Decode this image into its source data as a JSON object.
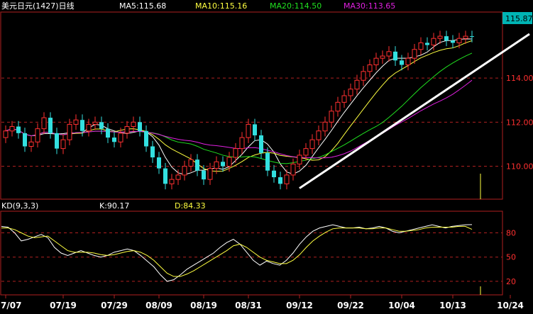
{
  "colors": {
    "background": "#000000",
    "frame": "#b02020",
    "grid": "#b02020",
    "up_candle": "#ff3030",
    "down_candle": "#33e0e0",
    "ma5": "#ffffff",
    "ma10": "#ffff40",
    "ma20": "#20e020",
    "ma30": "#e020e0",
    "k_line": "#ffffff",
    "d_line": "#ffff40",
    "trendline": "#ffffff",
    "axis_text": "#ff3030",
    "date_text": "#ffffff",
    "last_price_bg": "#00b4b4"
  },
  "price_header": {
    "title": "美元日元(1427)日线",
    "ma5": "MA5:115.68",
    "ma10": "MA10:115.16",
    "ma20": "MA20:114.50",
    "ma30": "MA30:113.65"
  },
  "last_price_tag": "115.87",
  "kd_header": {
    "title": "KD(9,3,3)",
    "k": "K:90.17",
    "d": "D:84.33"
  },
  "chart_data": [
    {
      "type": "candlestick",
      "y_ticks": [
        "114.00",
        "112.00",
        "110.00"
      ],
      "ylim": [
        108.6,
        116.9
      ],
      "x_tick_labels": [
        "7/07",
        "07/19",
        "07/29",
        "08/09",
        "08/19",
        "08/31",
        "09/12",
        "09/22",
        "10/04",
        "10/13",
        "10/24"
      ],
      "x_tick_bar_index": [
        0,
        9,
        17,
        24,
        31,
        38,
        46,
        54,
        62,
        70,
        79
      ],
      "close": [
        111.6,
        111.8,
        111.5,
        110.9,
        111.1,
        111.7,
        112.2,
        111.5,
        110.8,
        111.2,
        111.9,
        112.1,
        111.6,
        111.9,
        112.0,
        111.7,
        111.3,
        111.1,
        111.5,
        111.8,
        112.0,
        111.6,
        110.9,
        110.4,
        109.9,
        109.2,
        109.4,
        109.6,
        110.0,
        110.3,
        109.8,
        109.4,
        109.9,
        110.2,
        110.0,
        110.4,
        110.8,
        111.3,
        111.9,
        111.4,
        110.6,
        109.8,
        109.5,
        109.2,
        109.6,
        110.1,
        110.5,
        110.8,
        111.2,
        111.6,
        112.0,
        112.5,
        112.9,
        113.2,
        113.5,
        113.9,
        114.3,
        114.6,
        114.9,
        115.0,
        115.2,
        114.8,
        114.6,
        114.9,
        115.3,
        115.6,
        115.5,
        115.8,
        115.9,
        115.7,
        115.6,
        115.8,
        115.9,
        115.87
      ],
      "open": [
        111.3,
        111.6,
        111.8,
        111.5,
        110.9,
        111.1,
        111.7,
        112.2,
        111.5,
        110.8,
        111.2,
        111.9,
        112.1,
        111.6,
        111.9,
        112.0,
        111.7,
        111.3,
        111.1,
        111.5,
        111.8,
        112.0,
        111.6,
        110.9,
        110.4,
        109.9,
        109.2,
        109.4,
        109.6,
        110.0,
        110.3,
        109.8,
        109.4,
        109.9,
        110.2,
        110.0,
        110.4,
        110.8,
        111.3,
        111.9,
        111.4,
        110.6,
        109.8,
        109.5,
        109.2,
        109.6,
        110.1,
        110.5,
        110.8,
        111.2,
        111.6,
        112.0,
        112.5,
        112.9,
        113.2,
        113.5,
        113.9,
        114.3,
        114.6,
        114.9,
        115.0,
        115.2,
        114.8,
        114.6,
        114.9,
        115.3,
        115.6,
        115.5,
        115.8,
        115.9,
        115.7,
        115.6,
        115.8,
        115.9
      ],
      "ma_series": [
        {
          "name": "MA5",
          "color_key": "ma5"
        },
        {
          "name": "MA10",
          "color_key": "ma10"
        },
        {
          "name": "MA20",
          "color_key": "ma20"
        },
        {
          "name": "MA30",
          "color_key": "ma30"
        }
      ],
      "trendline": {
        "from": {
          "bar": 46,
          "price": 109.0
        },
        "to": {
          "bar": 82,
          "price": 116.0
        }
      }
    },
    {
      "type": "line",
      "y_ticks": [
        "80",
        "50",
        "20"
      ],
      "ylim": [
        5,
        105
      ],
      "series": [
        {
          "name": "K",
          "values": [
            88,
            87,
            80,
            70,
            72,
            75,
            78,
            74,
            62,
            55,
            52,
            55,
            58,
            55,
            52,
            50,
            52,
            56,
            58,
            60,
            58,
            52,
            45,
            38,
            28,
            20,
            22,
            28,
            35,
            40,
            45,
            50,
            55,
            62,
            68,
            72,
            66,
            56,
            46,
            40,
            45,
            42,
            40,
            46,
            55,
            66,
            75,
            82,
            86,
            88,
            90,
            88,
            86,
            86,
            87,
            85,
            86,
            88,
            86,
            82,
            80,
            82,
            84,
            86,
            88,
            90,
            88,
            86,
            88,
            89,
            90,
            90.17
          ]
        },
        {
          "name": "D",
          "values": [
            86,
            86,
            84,
            80,
            76,
            74,
            75,
            76,
            70,
            64,
            58,
            56,
            56,
            56,
            55,
            53,
            52,
            53,
            55,
            57,
            58,
            56,
            52,
            46,
            38,
            30,
            26,
            26,
            29,
            33,
            38,
            43,
            48,
            53,
            58,
            64,
            66,
            62,
            56,
            50,
            46,
            44,
            42,
            42,
            46,
            53,
            62,
            70,
            76,
            81,
            85,
            86,
            86,
            86,
            86,
            85,
            85,
            86,
            86,
            84,
            82,
            82,
            83,
            84,
            86,
            87,
            87,
            87,
            87,
            88,
            88,
            84.33
          ]
        }
      ]
    }
  ]
}
